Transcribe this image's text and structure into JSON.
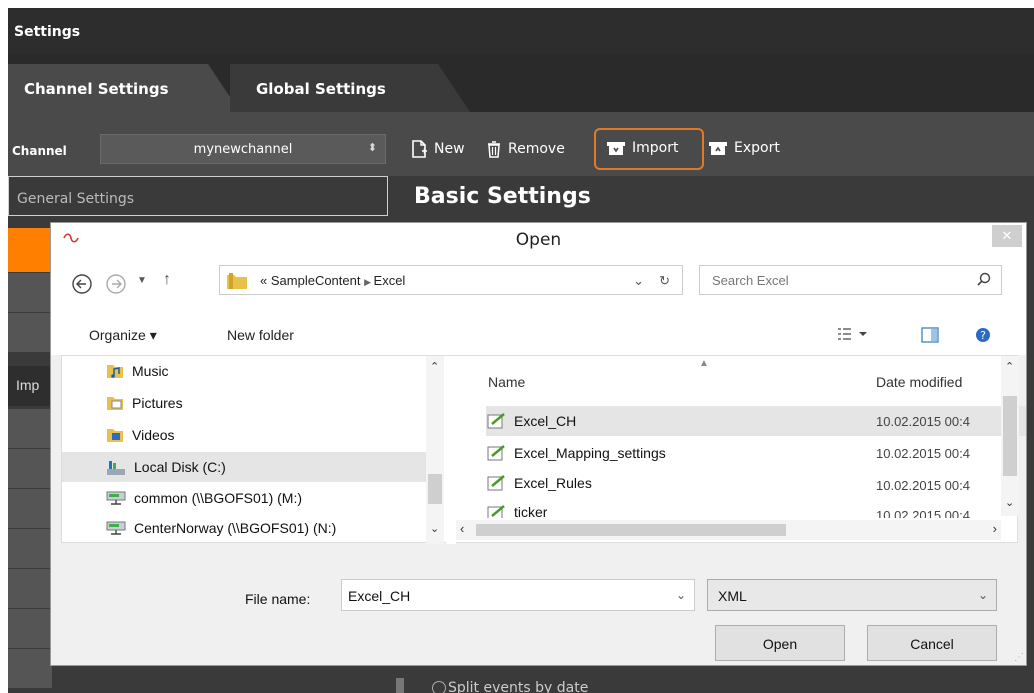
{
  "app": {
    "title": "Settings",
    "tabs": [
      "Channel Settings",
      "Global Settings"
    ],
    "channel_label": "Channel",
    "channel_value": "mynewchannel",
    "toolbar": {
      "new": "New",
      "remove": "Remove",
      "import": "Import",
      "export": "Export"
    },
    "left_header": "General Settings",
    "left_partial": "Imp",
    "main_heading": "Basic Settings",
    "bottom_hint": "Split events by date"
  },
  "dialog": {
    "title": "Open",
    "close": "✕",
    "path_prefix": "«",
    "path_parts": [
      "SampleContent",
      "Excel"
    ],
    "search_placeholder": "Search Excel",
    "organize": "Organize ▾",
    "new_folder": "New folder",
    "nav_items": [
      {
        "label": "Music",
        "icon": "music-folder-icon"
      },
      {
        "label": "Pictures",
        "icon": "pictures-folder-icon"
      },
      {
        "label": "Videos",
        "icon": "videos-folder-icon"
      },
      {
        "label": "Local Disk (C:)",
        "icon": "local-disk-icon"
      },
      {
        "label": "common (\\\\BGOFS01) (M:)",
        "icon": "network-drive-icon"
      },
      {
        "label": "CenterNorway (\\\\BGOFS01) (N:)",
        "icon": "network-drive-icon"
      }
    ],
    "columns": {
      "name": "Name",
      "date": "Date modified"
    },
    "files": [
      {
        "name": "Excel_CH",
        "date": "10.02.2015 00:4"
      },
      {
        "name": "Excel_Mapping_settings",
        "date": "10.02.2015 00:4"
      },
      {
        "name": "Excel_Rules",
        "date": "10.02.2015 00:4"
      },
      {
        "name": "ticker",
        "date": "10.02.2015 00:4"
      }
    ],
    "file_name_label": "File name:",
    "file_name_value": "Excel_CH",
    "file_type": "XML",
    "open_button": "Open",
    "cancel_button": "Cancel"
  },
  "colors": {
    "accent": "#ff7f00",
    "highlight": "#e07a2a"
  }
}
